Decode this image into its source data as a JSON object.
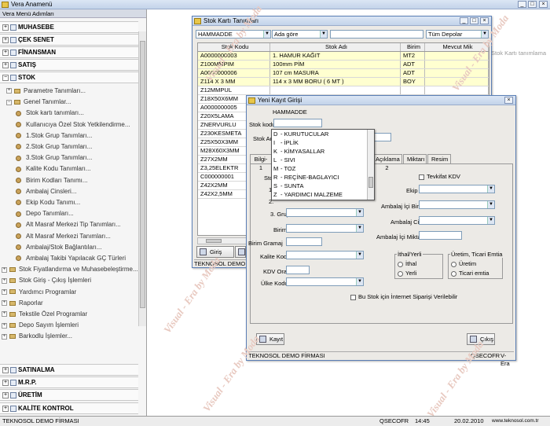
{
  "app": {
    "title": "Vera Anamenü"
  },
  "sidebar": {
    "header": "Vera Menü Adımları",
    "top_sections": [
      {
        "label": "MUHASEBE"
      },
      {
        "label": "ÇEK SENET"
      },
      {
        "label": "FİNANSMAN"
      },
      {
        "label": "SATIŞ"
      },
      {
        "label": "STOK"
      }
    ],
    "stok_items": [
      "Parametre Tanımları...",
      "Genel Tanımlar...",
      "Stok kartı tanımları...",
      "Kullanıcıya Özel Stok Yetkilendirme...",
      "1.Stok Grup Tanımları...",
      "2.Stok Grup Tanımları...",
      "3.Stok Grup Tanımları...",
      "Kalite Kodu Tanımları...",
      "Birim Kodları Tanımı...",
      "Ambalaj Cinsleri...",
      "Ekip Kodu Tanımı...",
      "Depo Tanımları...",
      "Alt Masraf Merkezi Tip Tanımları...",
      "Alt Masraf Merkezi Tanımları...",
      "Ambalaj/Stok Bağlantıları...",
      "Ambalaj Takibi Yapılacak GÇ Türleri",
      "Stok Fiyatlandırma ve Muhasebeleştirme...",
      "Stok Giriş - Çıkış İşlemleri",
      "Yardımcı Programlar",
      "Raporlar",
      "Tekstile Özel Programlar",
      "Depo Sayım İşlemleri",
      "Barkodlu İşlemler..."
    ],
    "bottom_sections": [
      {
        "label": "SATINALMA"
      },
      {
        "label": "M.R.P."
      },
      {
        "label": "ÜRETİM"
      },
      {
        "label": "KALİTE KONTROL"
      }
    ]
  },
  "status": {
    "company": "TEKNOSOL DEMO FİRMASI",
    "user": "QSECOFR",
    "time": "14:45",
    "date": "20.02.2010",
    "website": "www.teknosol.com.tr"
  },
  "stok_window": {
    "title": "Stok Kartı Tanımları",
    "group_value": "HAMMADDE",
    "sort_value": "Ada göre",
    "search_value": "",
    "depot_value": "Tüm Depolar",
    "columns": [
      "Stok Kodu",
      "Stok Adı",
      "Birim",
      "Mevcut Mik"
    ],
    "rows": [
      [
        "A0000000003",
        "1. HAMUR KAĞIT",
        "MT2",
        ""
      ],
      [
        "Z100MMPIM",
        "100mm PİM",
        "ADT",
        ""
      ],
      [
        "A0000000006",
        "107 cm MASURA",
        "ADT",
        ""
      ],
      [
        "Z114 X 3 MM",
        "114 x 3 MM BORU ( 6 MT )",
        "BOY",
        ""
      ],
      [
        "Z12MMPUL",
        "",
        "",
        ""
      ],
      [
        "Z18X50X6MM",
        "",
        "",
        ""
      ],
      [
        "A0000000005",
        "",
        "",
        ""
      ],
      [
        "Z20X5LAMA",
        "",
        "",
        ""
      ],
      [
        "ZNERVURLU",
        "",
        "",
        ""
      ],
      [
        "Z230KESMETA",
        "",
        "",
        ""
      ],
      [
        "Z25X50X3MM",
        "",
        "",
        ""
      ],
      [
        "M28X60X3MM",
        "",
        "",
        ""
      ],
      [
        "Z27X2MM",
        "",
        "",
        ""
      ],
      [
        "Z3,25ELEKTR",
        "",
        "",
        ""
      ],
      [
        "C000000001",
        "",
        "",
        ""
      ],
      [
        "Z42X2MM",
        "",
        "",
        ""
      ],
      [
        "Z42X2,5MM",
        "",
        "",
        ""
      ]
    ],
    "new_label": "Giriş",
    "footer": "TEKNOSOL DEMO FİRMASI"
  },
  "kayit_window": {
    "title": "Yeni Kayıt Girişi",
    "group_label": "HAMMADDE",
    "labels": {
      "stok_kodu": "Stok kodu",
      "stok_adi": "Stok Adı",
      "grup3": "3. Grup",
      "birim": "Birim",
      "birim_gramaj": "Birim Gramaj",
      "kalite_kodu": "Kalite Kodu",
      "kdv_orani": "KDV Oranı",
      "ulke_kodu": "Ülke Kodu",
      "ekip": "Ekip",
      "ambalaj_ici_birimi": "Ambalaj İçi Birimi",
      "ambalaj_cinsi": "Ambalaj Cinsi",
      "ambalaj_ici_miktari": "Ambalaj İçi Miktarı",
      "tevkifat": "Tevkifat KDV",
      "internet": "Bu Stok için İnternet Siparişi Verilebilir",
      "left_partial": [
        "Stok",
        "1.",
        "2."
      ]
    },
    "tabs": [
      "Bilgi-1",
      "Açıklama 2",
      "Miktarı",
      "Resim"
    ],
    "ithal_group": {
      "title": "İthal/Yerli",
      "options": [
        "İthal",
        "Yerli"
      ]
    },
    "uretim_group": {
      "title": "Üretim, Ticari Emtia",
      "options": [
        "Üretim",
        "Ticari emtia"
      ]
    },
    "save_label": "Kayıt",
    "exit_label": "Çıkış",
    "footer_company": "TEKNOSOL DEMO FİRMASI",
    "footer_user": "QSECOFR",
    "footer_app": "V-Era"
  },
  "dropdown_list": {
    "items": [
      {
        "key": "D",
        "label": "- KURUTUCULAR"
      },
      {
        "key": "I",
        "label": "- İPLİK"
      },
      {
        "key": "K",
        "label": "- KİMYASALLAR"
      },
      {
        "key": "L",
        "label": "- SIVI"
      },
      {
        "key": "M",
        "label": "- TOZ"
      },
      {
        "key": "R",
        "label": "- REÇİNE-BAGLAYICI"
      },
      {
        "key": "S",
        "label": "- SUNTA"
      },
      {
        "key": "Z",
        "label": "- YARDIMCI MALZEME"
      }
    ]
  },
  "background_text": "Stok Kartı tanımlama sistemi...",
  "watermark": "Visual - Era by Moda"
}
